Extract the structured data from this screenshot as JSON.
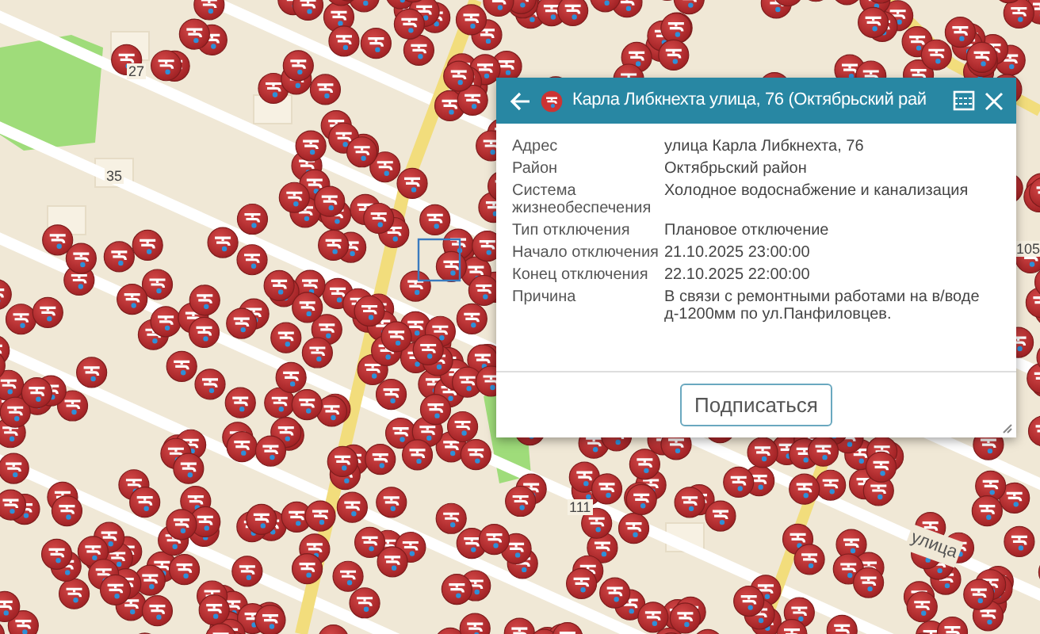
{
  "map": {
    "labels": [
      {
        "text": "27",
        "kind": "number"
      },
      {
        "text": "35",
        "kind": "number"
      },
      {
        "text": "111",
        "kind": "number"
      },
      {
        "text": "105",
        "kind": "number"
      },
      {
        "text": "улица",
        "kind": "street"
      }
    ]
  },
  "popup": {
    "title": "Карла Либкнехта улица, 76 (Октябрьский рай",
    "rows": [
      {
        "label": "Адрес",
        "value": "улица Карла Либкнехта, 76"
      },
      {
        "label": "Район",
        "value": "Октябрьский район"
      },
      {
        "label": "Система жизнеобеспечения",
        "value": "Холодное водоснабжение и канализация"
      },
      {
        "label": "Тип отключения",
        "value": "Плановое отключение"
      },
      {
        "label": "Начало отключения",
        "value": "21.10.2025 23:00:00"
      },
      {
        "label": "Конец отключения",
        "value": "22.10.2025 22:00:00"
      },
      {
        "label": "Причина",
        "value": "В связи с ремонтными работами на в/воде д-1200мм по ул.Панфиловцев."
      }
    ],
    "button": "Подписаться"
  }
}
